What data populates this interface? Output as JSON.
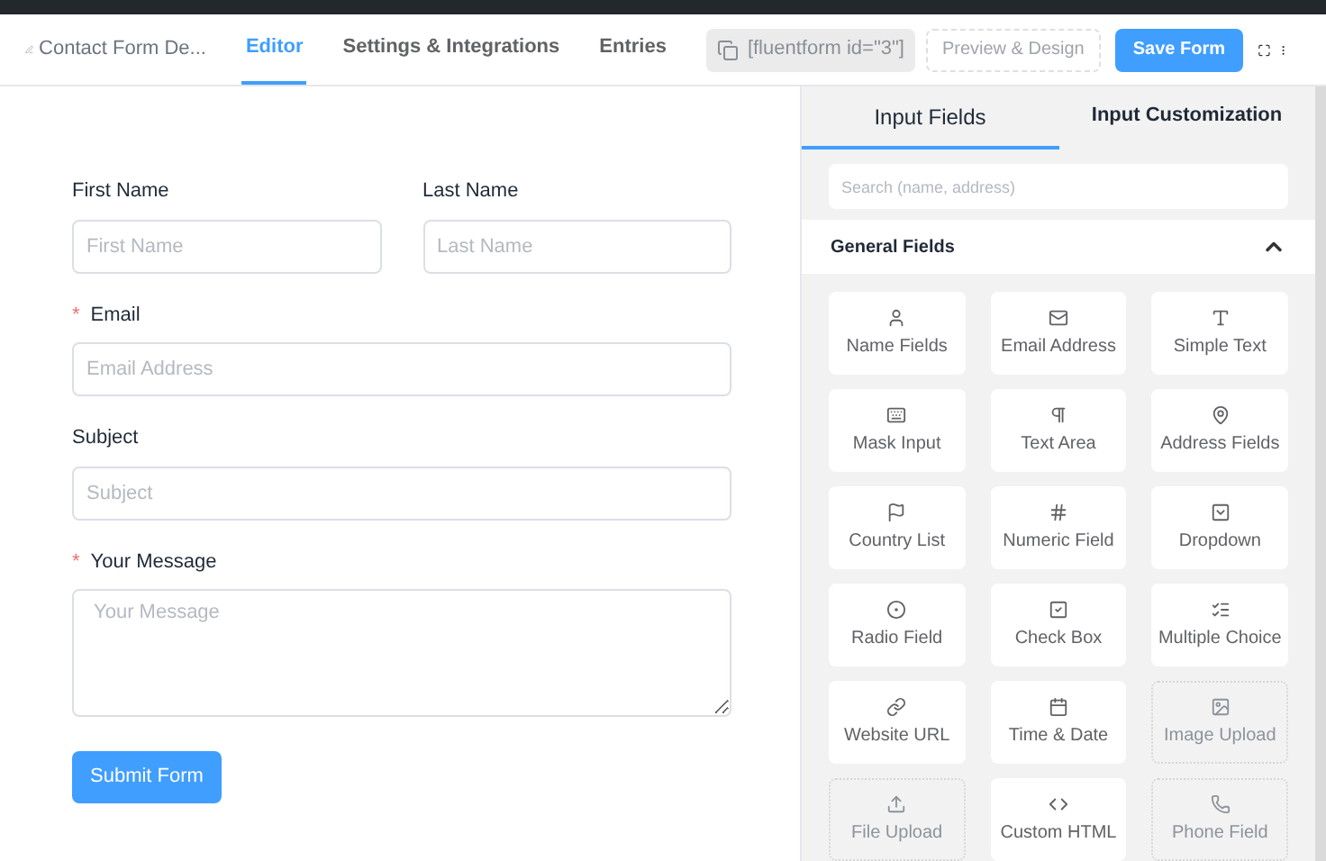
{
  "header": {
    "form_title": "Contact Form De...",
    "tabs": [
      {
        "label": "Editor",
        "selected": true
      },
      {
        "label": "Settings & Integrations",
        "selected": false
      },
      {
        "label": "Entries",
        "selected": false
      }
    ],
    "shortcode": "[fluentform id=\"3\"]",
    "preview_button": "Preview & Design",
    "save_button": "Save Form"
  },
  "form": {
    "rows": [
      {
        "fields": [
          {
            "label": "First Name",
            "kind": "input",
            "placeholder": "First Name"
          },
          {
            "label": "Last Name",
            "kind": "input",
            "placeholder": "Last Name"
          }
        ]
      },
      {
        "fields": [
          {
            "label": "Email",
            "required_mark": "*",
            "kind": "input",
            "placeholder": "Email Address"
          }
        ]
      },
      {
        "fields": [
          {
            "label": "Subject",
            "kind": "input",
            "placeholder": "Subject"
          }
        ]
      },
      {
        "fields": [
          {
            "label": "Your Message",
            "required_mark": "*",
            "kind": "textarea",
            "placeholder": "Your Message"
          }
        ]
      }
    ],
    "submit": "Submit Form"
  },
  "panel": {
    "tabs": [
      {
        "label": "Input Fields",
        "selected": true
      },
      {
        "label": "Input Customization",
        "selected": false
      }
    ],
    "search": {
      "placeholder": "Search (name, address)"
    },
    "section": {
      "title": "General Fields",
      "expanded": true
    },
    "items": [
      {
        "label": "Name Fields",
        "disabled": false
      },
      {
        "label": "Email Address",
        "disabled": false
      },
      {
        "label": "Simple Text",
        "disabled": false
      },
      {
        "label": "Mask Input",
        "disabled": false
      },
      {
        "label": "Text Area",
        "disabled": false
      },
      {
        "label": "Address Fields",
        "disabled": false
      },
      {
        "label": "Country List",
        "disabled": false
      },
      {
        "label": "Numeric Field",
        "disabled": false
      },
      {
        "label": "Dropdown",
        "disabled": false
      },
      {
        "label": "Radio Field",
        "disabled": false
      },
      {
        "label": "Check Box",
        "disabled": false
      },
      {
        "label": "Multiple Choice",
        "disabled": false
      },
      {
        "label": "Website URL",
        "disabled": false
      },
      {
        "label": "Time & Date",
        "disabled": false
      },
      {
        "label": "Image Upload",
        "disabled": true
      },
      {
        "label": "File Upload",
        "disabled": true
      },
      {
        "label": "Custom HTML",
        "disabled": false
      },
      {
        "label": "Phone Field",
        "disabled": true
      }
    ]
  }
}
